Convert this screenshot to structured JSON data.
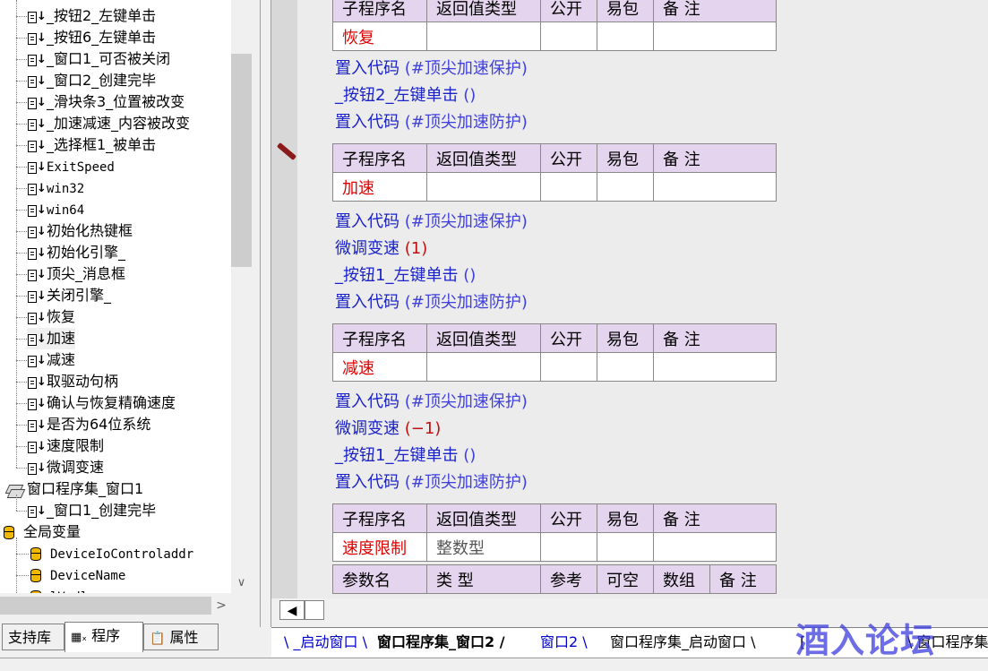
{
  "tree": {
    "items": [
      {
        "label": "_按钮2_左键单击",
        "icon": "subroutine-icon"
      },
      {
        "label": "_按钮6_左键单击",
        "icon": "subroutine-icon"
      },
      {
        "label": "_窗口1_可否被关闭",
        "icon": "subroutine-icon"
      },
      {
        "label": "_窗口2_创建完毕",
        "icon": "subroutine-icon"
      },
      {
        "label": "_滑块条3_位置被改变",
        "icon": "subroutine-icon"
      },
      {
        "label": "_加速减速_内容被改变",
        "icon": "subroutine-icon"
      },
      {
        "label": "_选择框1_被单击",
        "icon": "subroutine-icon"
      },
      {
        "label": "ExitSpeed",
        "icon": "subroutine-icon",
        "mono": true
      },
      {
        "label": "win32",
        "icon": "subroutine-icon",
        "mono": true
      },
      {
        "label": "win64",
        "icon": "subroutine-icon",
        "mono": true
      },
      {
        "label": "初始化热键框",
        "icon": "subroutine-icon"
      },
      {
        "label": "初始化引擎_",
        "icon": "subroutine-icon"
      },
      {
        "label": "顶尖_消息框",
        "icon": "subroutine-icon"
      },
      {
        "label": "关闭引擎_",
        "icon": "subroutine-icon"
      },
      {
        "label": "恢复",
        "icon": "subroutine-icon"
      },
      {
        "label": "加速",
        "icon": "subroutine-icon",
        "selected": true
      },
      {
        "label": "减速",
        "icon": "subroutine-icon"
      },
      {
        "label": "取驱动句柄",
        "icon": "subroutine-icon"
      },
      {
        "label": "确认与恢复精确速度",
        "icon": "subroutine-icon"
      },
      {
        "label": "是否为64位系统",
        "icon": "subroutine-icon"
      },
      {
        "label": "速度限制",
        "icon": "subroutine-icon"
      },
      {
        "label": "微调变速",
        "icon": "subroutine-icon"
      }
    ],
    "set_label": "窗口程序集_窗口1",
    "set_child": "_窗口1_创建完毕",
    "globals_label": "全局变量",
    "global_vars": [
      "DeviceIoControladdr",
      "DeviceName",
      "lVxdl"
    ]
  },
  "left_tabs": {
    "support": "支持库",
    "program": "程序",
    "property": "属性"
  },
  "headers": {
    "name": "子程序名",
    "ret": "返回值类型",
    "public": "公开",
    "easy": "易包",
    "note": "备 注",
    "param": "参数名",
    "type": "类 型",
    "ref": "参考",
    "nullable": "可空",
    "array": "数组"
  },
  "blocks": [
    {
      "name": "恢复",
      "code": [
        {
          "fn": "置入代码",
          "arg": "(#顶尖加速保护)"
        },
        {
          "fn": "_按钮2_左键单击",
          "arg": "()"
        },
        {
          "fn": "置入代码",
          "arg": "(#顶尖加速防护)"
        }
      ]
    },
    {
      "name": "加速",
      "code": [
        {
          "fn": "置入代码",
          "arg": "(#顶尖加速保护)"
        },
        {
          "fn": "微调变速",
          "arg": "(1)"
        },
        {
          "fn": "_按钮1_左键单击",
          "arg": "()"
        },
        {
          "fn": "置入代码",
          "arg": "(#顶尖加速防护)"
        }
      ]
    },
    {
      "name": "减速",
      "code": [
        {
          "fn": "置入代码",
          "arg": "(#顶尖加速保护)"
        },
        {
          "fn": "微调变速",
          "arg": "(−1)"
        },
        {
          "fn": "_按钮1_左键单击",
          "arg": "()"
        },
        {
          "fn": "置入代码",
          "arg": "(#顶尖加速防护)"
        }
      ]
    },
    {
      "name": "速度限制",
      "ret_type": "整数型"
    }
  ],
  "doc_tabs": [
    "_启动窗口",
    "窗口程序集_窗口2",
    "窗口2",
    "窗口程序集_启动窗口",
    "窗口程序集_"
  ],
  "doc_tab_partial": "[",
  "watermark": "酒入论坛"
}
